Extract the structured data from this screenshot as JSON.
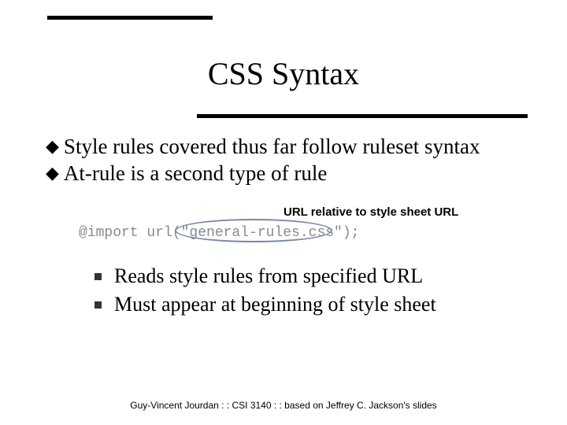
{
  "title": "CSS Syntax",
  "bullets": [
    "Style rules covered thus far follow ruleset syntax",
    "At-rule is a second type of rule"
  ],
  "annotation": "URL relative to style sheet URL",
  "code": "@import url(\"general-rules.css\");",
  "sub_bullets": [
    "Reads style rules from specified URL",
    "Must appear at beginning of style sheet"
  ],
  "footer": "Guy-Vincent Jourdan : : CSI 3140 : : based on Jeffrey C. Jackson's slides"
}
